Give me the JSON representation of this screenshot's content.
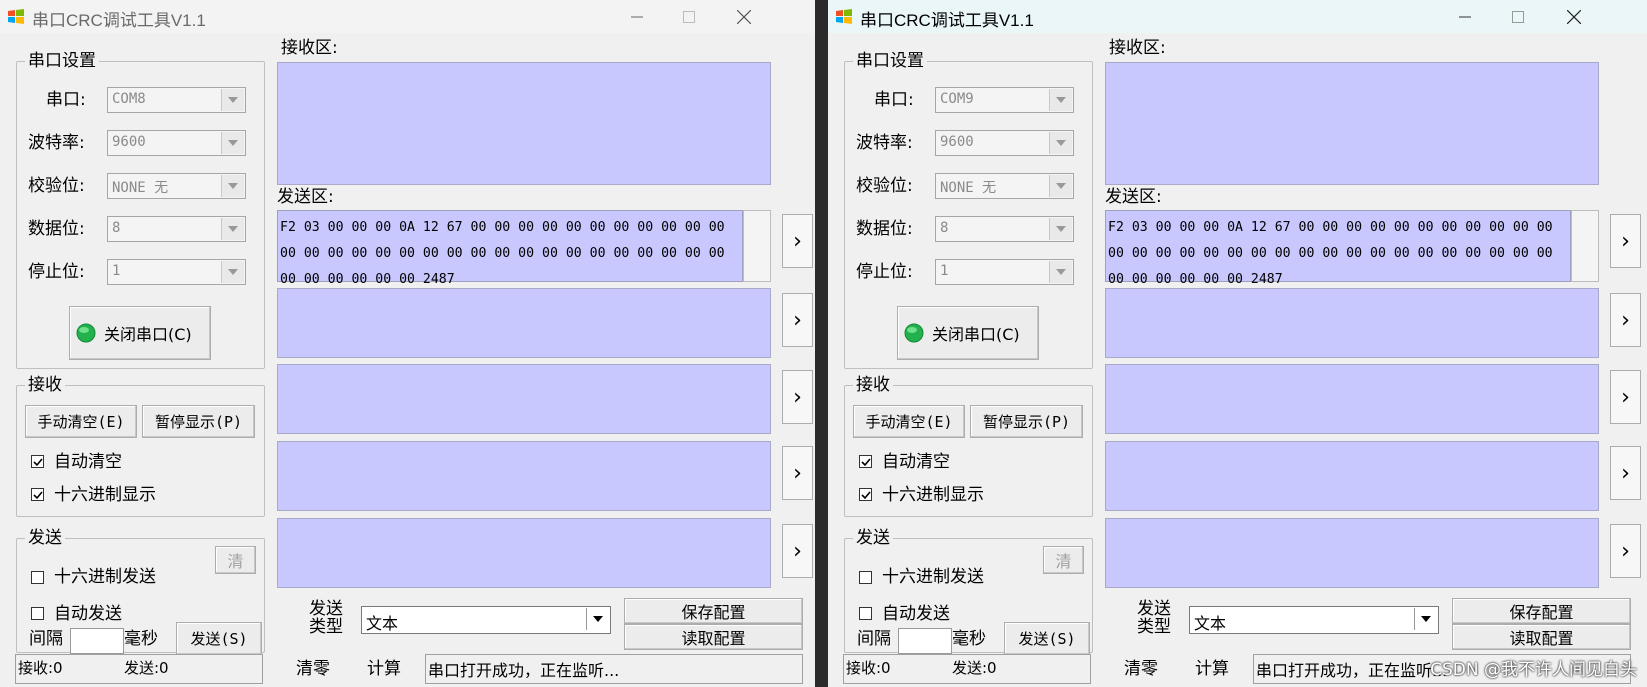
{
  "windows": [
    {
      "title": "串口CRC调试工具V1.1",
      "serial_group": {
        "legend": "串口设置",
        "port_label": "串口:",
        "port_value": "COM8",
        "baud_label": "波特率:",
        "baud_value": "9600",
        "parity_label": "校验位:",
        "parity_value": "NONE  无",
        "databits_label": "数据位:",
        "databits_value": "8",
        "stopbits_label": "停止位:",
        "stopbits_value": "1",
        "toggle_button": "关闭串口(C)"
      },
      "receive_group": {
        "legend": "接收",
        "clear_button": "手动清空(E)",
        "pause_button": "暂停显示(P)",
        "auto_clear_label": "自动清空",
        "auto_clear_checked": true,
        "hex_display_label": "十六进制显示",
        "hex_display_checked": true
      },
      "send_group": {
        "legend": "发送",
        "clear_button": "清",
        "hex_send_label": "十六进制发送",
        "hex_send_checked": false,
        "auto_send_label": "自动发送",
        "auto_send_checked": false,
        "interval_label": "间隔",
        "interval_value": "",
        "ms_label": "毫秒",
        "send_button": "发送(S)"
      },
      "receive_area_label": "接收区:",
      "send_area_label": "发送区:",
      "send_text": "F2 03 00 00 00 0A 12 67 00 00 00 00 00 00 00 00 00 00 00 00 00 00 00 00 00 00 00 00 00 00 00 00 00 00 00 00 00 00 00 00 00 00 00 00 2487",
      "side_button": "›",
      "send_type_label": "发送类型",
      "send_type_value": "文本",
      "save_config_button": "保存配置",
      "load_config_button": "读取配置",
      "reset_button": "清零",
      "calc_button": "计算",
      "status_text": "串口打开成功，正在监听...",
      "rx_count": "接收:0",
      "tx_count": "发送:0"
    },
    {
      "title": "串口CRC调试工具V1.1",
      "serial_group": {
        "legend": "串口设置",
        "port_label": "串口:",
        "port_value": "COM9",
        "baud_label": "波特率:",
        "baud_value": "9600",
        "parity_label": "校验位:",
        "parity_value": "NONE  无",
        "databits_label": "数据位:",
        "databits_value": "8",
        "stopbits_label": "停止位:",
        "stopbits_value": "1",
        "toggle_button": "关闭串口(C)"
      },
      "receive_group": {
        "legend": "接收",
        "clear_button": "手动清空(E)",
        "pause_button": "暂停显示(P)",
        "auto_clear_label": "自动清空",
        "auto_clear_checked": true,
        "hex_display_label": "十六进制显示",
        "hex_display_checked": true
      },
      "send_group": {
        "legend": "发送",
        "clear_button": "清",
        "hex_send_label": "十六进制发送",
        "hex_send_checked": false,
        "auto_send_label": "自动发送",
        "auto_send_checked": false,
        "interval_label": "间隔",
        "interval_value": "",
        "ms_label": "毫秒",
        "send_button": "发送(S)"
      },
      "receive_area_label": "接收区:",
      "send_area_label": "发送区:",
      "send_text": "F2 03 00 00 00 0A 12 67 00 00 00 00 00 00 00 00 00 00 00 00 00 00 00 00 00 00 00 00 00 00 00 00 00 00 00 00 00 00 00 00 00 00 00 00 2487",
      "side_button": "›",
      "send_type_label": "发送类型",
      "send_type_value": "文本",
      "save_config_button": "保存配置",
      "load_config_button": "读取配置",
      "reset_button": "清零",
      "calc_button": "计算",
      "status_text": "串口打开成功，正在监听...",
      "rx_count": "接收:0",
      "tx_count": "发送:0"
    }
  ],
  "icons": {
    "app": "app-windows-flag-icon",
    "minimize": "minimize-icon",
    "maximize": "maximize-icon",
    "close": "close-icon",
    "dropdown": "dropdown-arrow-icon",
    "led": "green-led-icon",
    "check": "checkmark-icon"
  },
  "colors": {
    "text_area_bg": "#c8c8ff",
    "led_green": "#22b14c",
    "window_bg": "#f0f0f0"
  },
  "watermark": "CSDN @我不许人间见白头"
}
